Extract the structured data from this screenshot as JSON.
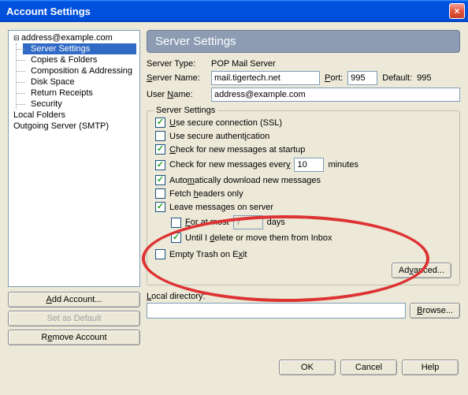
{
  "window": {
    "title": "Account Settings",
    "close": "×"
  },
  "tree": {
    "root": "address@example.com",
    "items": [
      "Server Settings",
      "Copies & Folders",
      "Composition & Addressing",
      "Disk Space",
      "Return Receipts",
      "Security"
    ],
    "localFolders": "Local Folders",
    "outgoing": "Outgoing Server (SMTP)"
  },
  "acctButtons": {
    "add": "Add Account...",
    "setDefault": "Set as Default",
    "remove": "Remove Account"
  },
  "header": "Server Settings",
  "server": {
    "typeLabel": "Server Type:",
    "typeValue": "POP Mail Server",
    "nameLabel": "Server Name:",
    "nameValue": "mail.tigertech.net",
    "portLabel": "Port:",
    "portValue": "995",
    "defaultLabel": "Default:",
    "defaultValue": "995",
    "userLabel": "User Name:",
    "userValue": "address@example.com"
  },
  "settings": {
    "legend": "Server Settings",
    "ssl": "Use secure connection (SSL)",
    "secureAuth": "Use secure authentication",
    "checkStartup": "Check for new messages at startup",
    "checkEvery": "Check for new messages every",
    "checkEveryValue": "10",
    "minutes": "minutes",
    "autoDownload": "Automatically download new messages",
    "fetchHeaders": "Fetch headers only",
    "leaveOnServer": "Leave messages on server",
    "forAtMost": "For at most",
    "forAtMostValue": "7",
    "days": "days",
    "untilDelete": "Until I delete or move them from Inbox",
    "emptyTrash": "Empty Trash on Exit",
    "advanced": "Advanced..."
  },
  "localDir": {
    "label": "Local directory:",
    "value": "",
    "browse": "Browse..."
  },
  "dialog": {
    "ok": "OK",
    "cancel": "Cancel",
    "help": "Help"
  }
}
